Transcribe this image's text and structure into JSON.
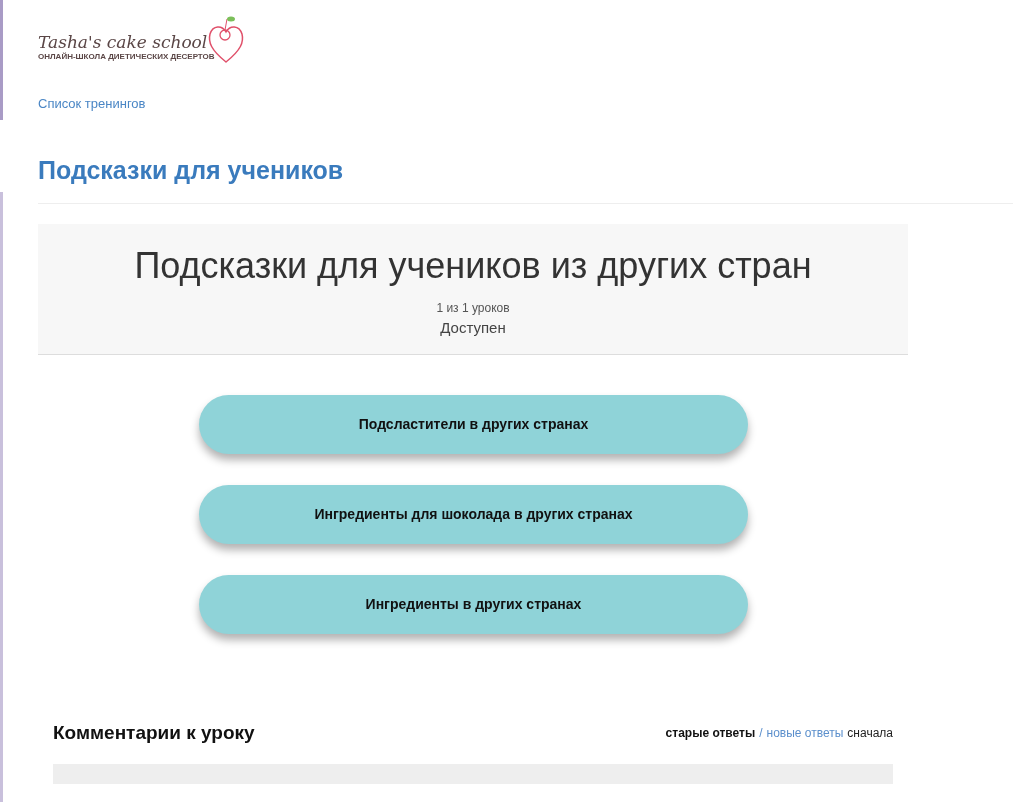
{
  "logo": {
    "title": "Tasha's cake school",
    "subtitle": "ОНЛАЙН-ШКОЛА ДИЕТИЧЕСКИХ ДЕСЕРТОВ"
  },
  "breadcrumb": "Список тренингов",
  "page_title": "Подсказки для учеников",
  "lesson": {
    "title": "Подсказки для учеников из других стран",
    "progress": "1 из 1 уроков",
    "status": "Доступен"
  },
  "buttons": [
    "Подсластители в других странах",
    "Ингредиенты для шоколада в других странах",
    "Ингредиенты в других странах"
  ],
  "comments": {
    "title": "Комментарии к уроку",
    "sort": [
      {
        "label": "старые ответы",
        "selected": true
      },
      {
        "label": "новые ответы",
        "selected": false
      }
    ],
    "separator": "/",
    "suffix": "сначала"
  }
}
